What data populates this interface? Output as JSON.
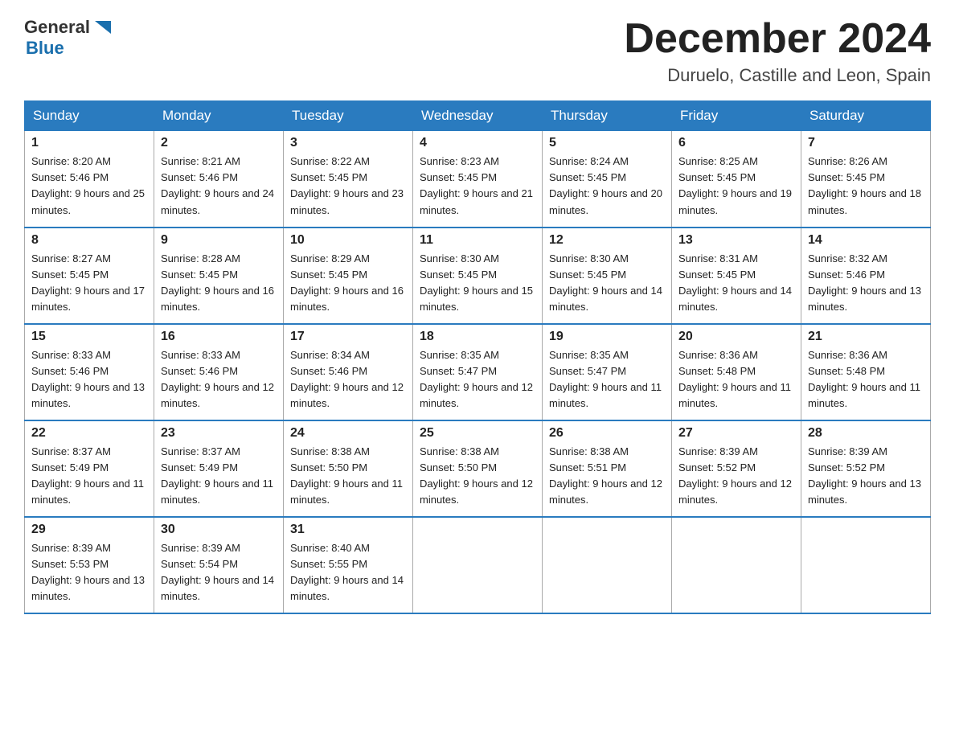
{
  "logo": {
    "general": "General",
    "blue": "Blue"
  },
  "title": "December 2024",
  "subtitle": "Duruelo, Castille and Leon, Spain",
  "days_of_week": [
    "Sunday",
    "Monday",
    "Tuesday",
    "Wednesday",
    "Thursday",
    "Friday",
    "Saturday"
  ],
  "weeks": [
    [
      {
        "num": "1",
        "sunrise": "8:20 AM",
        "sunset": "5:46 PM",
        "daylight": "9 hours and 25 minutes."
      },
      {
        "num": "2",
        "sunrise": "8:21 AM",
        "sunset": "5:46 PM",
        "daylight": "9 hours and 24 minutes."
      },
      {
        "num": "3",
        "sunrise": "8:22 AM",
        "sunset": "5:45 PM",
        "daylight": "9 hours and 23 minutes."
      },
      {
        "num": "4",
        "sunrise": "8:23 AM",
        "sunset": "5:45 PM",
        "daylight": "9 hours and 21 minutes."
      },
      {
        "num": "5",
        "sunrise": "8:24 AM",
        "sunset": "5:45 PM",
        "daylight": "9 hours and 20 minutes."
      },
      {
        "num": "6",
        "sunrise": "8:25 AM",
        "sunset": "5:45 PM",
        "daylight": "9 hours and 19 minutes."
      },
      {
        "num": "7",
        "sunrise": "8:26 AM",
        "sunset": "5:45 PM",
        "daylight": "9 hours and 18 minutes."
      }
    ],
    [
      {
        "num": "8",
        "sunrise": "8:27 AM",
        "sunset": "5:45 PM",
        "daylight": "9 hours and 17 minutes."
      },
      {
        "num": "9",
        "sunrise": "8:28 AM",
        "sunset": "5:45 PM",
        "daylight": "9 hours and 16 minutes."
      },
      {
        "num": "10",
        "sunrise": "8:29 AM",
        "sunset": "5:45 PM",
        "daylight": "9 hours and 16 minutes."
      },
      {
        "num": "11",
        "sunrise": "8:30 AM",
        "sunset": "5:45 PM",
        "daylight": "9 hours and 15 minutes."
      },
      {
        "num": "12",
        "sunrise": "8:30 AM",
        "sunset": "5:45 PM",
        "daylight": "9 hours and 14 minutes."
      },
      {
        "num": "13",
        "sunrise": "8:31 AM",
        "sunset": "5:45 PM",
        "daylight": "9 hours and 14 minutes."
      },
      {
        "num": "14",
        "sunrise": "8:32 AM",
        "sunset": "5:46 PM",
        "daylight": "9 hours and 13 minutes."
      }
    ],
    [
      {
        "num": "15",
        "sunrise": "8:33 AM",
        "sunset": "5:46 PM",
        "daylight": "9 hours and 13 minutes."
      },
      {
        "num": "16",
        "sunrise": "8:33 AM",
        "sunset": "5:46 PM",
        "daylight": "9 hours and 12 minutes."
      },
      {
        "num": "17",
        "sunrise": "8:34 AM",
        "sunset": "5:46 PM",
        "daylight": "9 hours and 12 minutes."
      },
      {
        "num": "18",
        "sunrise": "8:35 AM",
        "sunset": "5:47 PM",
        "daylight": "9 hours and 12 minutes."
      },
      {
        "num": "19",
        "sunrise": "8:35 AM",
        "sunset": "5:47 PM",
        "daylight": "9 hours and 11 minutes."
      },
      {
        "num": "20",
        "sunrise": "8:36 AM",
        "sunset": "5:48 PM",
        "daylight": "9 hours and 11 minutes."
      },
      {
        "num": "21",
        "sunrise": "8:36 AM",
        "sunset": "5:48 PM",
        "daylight": "9 hours and 11 minutes."
      }
    ],
    [
      {
        "num": "22",
        "sunrise": "8:37 AM",
        "sunset": "5:49 PM",
        "daylight": "9 hours and 11 minutes."
      },
      {
        "num": "23",
        "sunrise": "8:37 AM",
        "sunset": "5:49 PM",
        "daylight": "9 hours and 11 minutes."
      },
      {
        "num": "24",
        "sunrise": "8:38 AM",
        "sunset": "5:50 PM",
        "daylight": "9 hours and 11 minutes."
      },
      {
        "num": "25",
        "sunrise": "8:38 AM",
        "sunset": "5:50 PM",
        "daylight": "9 hours and 12 minutes."
      },
      {
        "num": "26",
        "sunrise": "8:38 AM",
        "sunset": "5:51 PM",
        "daylight": "9 hours and 12 minutes."
      },
      {
        "num": "27",
        "sunrise": "8:39 AM",
        "sunset": "5:52 PM",
        "daylight": "9 hours and 12 minutes."
      },
      {
        "num": "28",
        "sunrise": "8:39 AM",
        "sunset": "5:52 PM",
        "daylight": "9 hours and 13 minutes."
      }
    ],
    [
      {
        "num": "29",
        "sunrise": "8:39 AM",
        "sunset": "5:53 PM",
        "daylight": "9 hours and 13 minutes."
      },
      {
        "num": "30",
        "sunrise": "8:39 AM",
        "sunset": "5:54 PM",
        "daylight": "9 hours and 14 minutes."
      },
      {
        "num": "31",
        "sunrise": "8:40 AM",
        "sunset": "5:55 PM",
        "daylight": "9 hours and 14 minutes."
      },
      null,
      null,
      null,
      null
    ]
  ]
}
